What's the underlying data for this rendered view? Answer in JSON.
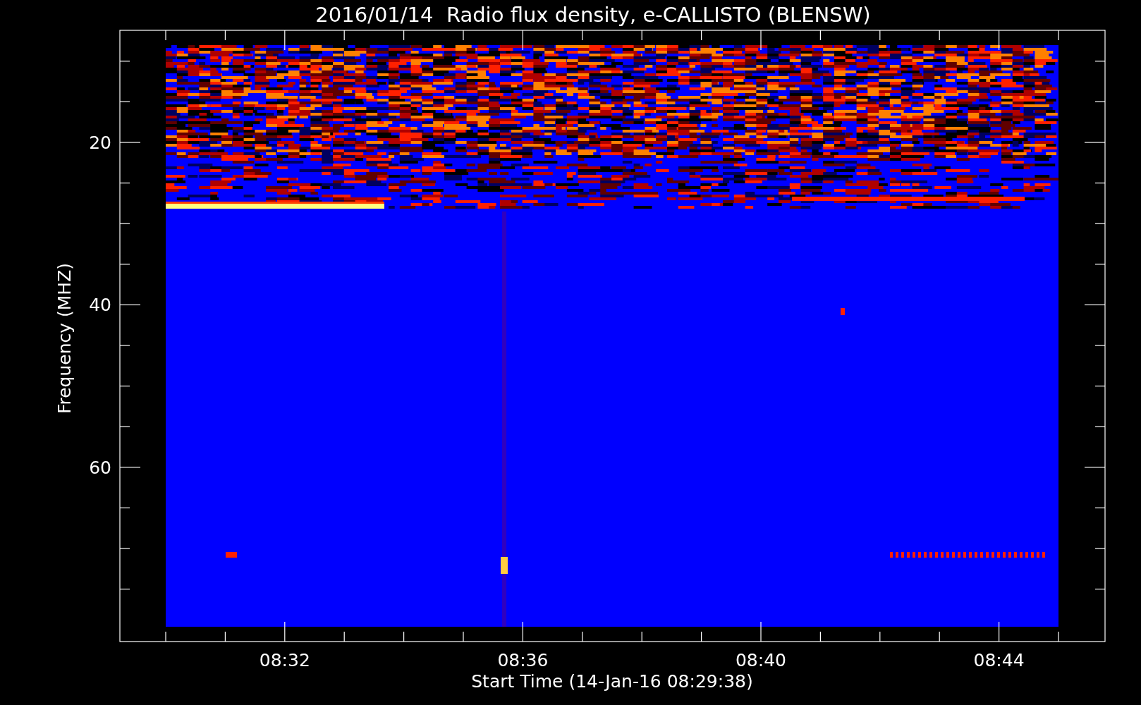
{
  "title": "2016/01/14  Radio flux density, e-CALLISTO (BLENSW)",
  "y_axis": {
    "label": "Frequency (MHZ)",
    "ticks": [
      "20",
      "40",
      "60"
    ]
  },
  "x_axis": {
    "label": "Start Time (14-Jan-16 08:29:38)",
    "ticks": [
      "08:32",
      "08:36",
      "08:40",
      "08:44"
    ]
  }
}
